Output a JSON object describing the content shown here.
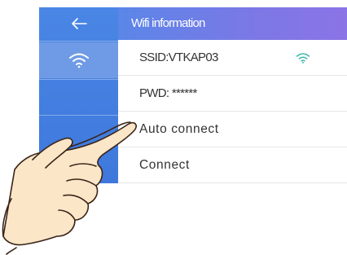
{
  "header": {
    "title": "Wifi information"
  },
  "sidebar": {
    "items": [
      {
        "icon": "back-arrow-icon"
      },
      {
        "icon": "wifi-icon"
      }
    ]
  },
  "rows": {
    "ssid": "SSID:VTKAP03",
    "pwd": "PWD: ******",
    "auto_connect": "Auto connect",
    "connect": "Connect"
  },
  "colors": {
    "sidebar": "#4282e0",
    "sidebar_selected": "#6f9be6",
    "title_gradient_start": "#5b86e8",
    "title_gradient_end": "#8a74e6",
    "wifi_signal": "#3cb8a8"
  }
}
